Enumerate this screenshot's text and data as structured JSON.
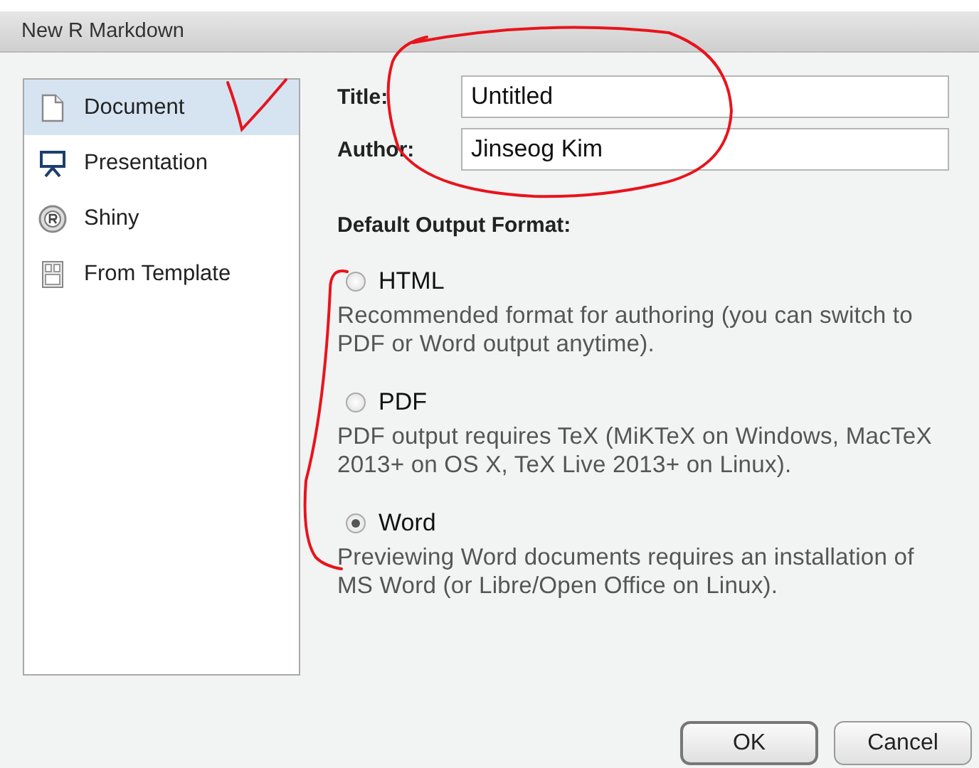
{
  "window": {
    "title": "New R Markdown"
  },
  "sidebar": {
    "items": [
      {
        "label": "Document",
        "kind": "document",
        "selected": true
      },
      {
        "label": "Presentation",
        "kind": "presentation",
        "selected": false
      },
      {
        "label": "Shiny",
        "kind": "shiny",
        "selected": false
      },
      {
        "label": "From Template",
        "kind": "template",
        "selected": false
      }
    ]
  },
  "fields": [
    {
      "label": "Title:",
      "value": "Untitled"
    },
    {
      "label": "Author:",
      "value": "Jinseog Kim"
    }
  ],
  "output_format": {
    "heading": "Default Output Format:",
    "options": [
      {
        "label": "HTML",
        "description": "Recommended format for authoring (you can switch to PDF or Word output anytime).",
        "selected": false
      },
      {
        "label": "PDF",
        "description": "PDF output requires TeX (MiKTeX on Windows, MacTeX 2013+ on OS X, TeX Live 2013+ on Linux).",
        "selected": false
      },
      {
        "label": "Word",
        "description": "Previewing Word documents requires an installation of MS Word (or Libre/Open Office on Linux).",
        "selected": true
      }
    ]
  },
  "buttons": [
    {
      "label": "OK",
      "kind": "default"
    },
    {
      "label": "Cancel",
      "kind": "normal"
    }
  ]
}
